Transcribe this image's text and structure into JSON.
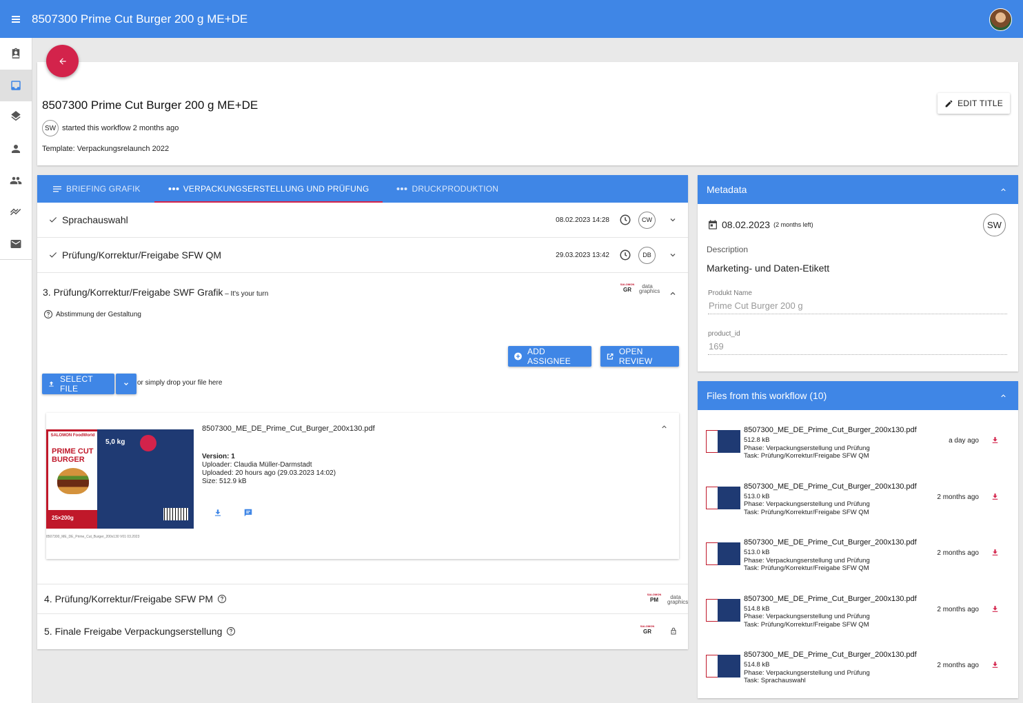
{
  "topbar": {
    "title": "8507300 Prime Cut Burger 200 g ME+DE"
  },
  "header": {
    "title": "8507300 Prime Cut Burger 200 g ME+DE",
    "initials": "SW",
    "started": "started this workflow 2 months ago",
    "template": "Template: Verpackungsrelaunch 2022",
    "edit_label": "EDIT TITLE"
  },
  "tabs": [
    {
      "label": "BRIEFING GRAFIK",
      "icon": "notes-icon"
    },
    {
      "label": "VERPACKUNGSERSTELLUNG UND PRÜFUNG",
      "icon": "steps-icon",
      "active": true
    },
    {
      "label": "DRUCKPRODUKTION",
      "icon": "steps-icon"
    }
  ],
  "steps": {
    "done": [
      {
        "name": "Sprachauswahl",
        "date": "08.02.2023 14:28",
        "initials": "CW"
      },
      {
        "name": "Prüfung/Korrektur/Freigabe SFW QM",
        "date": "29.03.2023 13:42",
        "initials": "DB"
      }
    ],
    "current": {
      "title": "3. Prüfung/Korrektur/Freigabe SWF Grafik",
      "turn": " – It's your turn",
      "logo_gr": "GR",
      "logo_sub": "SALOMON FoodWorld",
      "logo_data": "data graphics",
      "hint": "Abstimmung der Gestaltung",
      "add_assignee": "ADD ASSIGNEE",
      "open_review": "OPEN REVIEW",
      "select_file": "SELECT FILE",
      "drop_text": "or simply drop your file here",
      "file": {
        "name": "8507300_ME_DE_Prime_Cut_Burger_200x130.pdf",
        "version": "Version: 1",
        "uploader": "Uploader: Claudia Müller-Darmstadt",
        "uploaded": "Uploaded: 20 hours ago (29.03.2023 14:02)",
        "size": "Size: 512.9 kB",
        "caption": "8507300_ME_DE_Prime_Cut_Burger_200x130   V01   03.2023",
        "thumb_brand": "SALOMON FoodWorld",
        "thumb_title": "PRIME CUT",
        "thumb_subtitle": "BURGER",
        "thumb_weight": "5,0 kg",
        "thumb_count": "25×200g"
      }
    },
    "later": [
      {
        "name": "4. Prüfung/Korrektur/Freigabe SFW PM",
        "logo": "PM"
      },
      {
        "name": "5. Finale Freigabe Verpackungserstellung",
        "logo": "GR"
      }
    ]
  },
  "metadata": {
    "title": "Metadata",
    "date": "08.02.2023",
    "date_note": "(2 months left)",
    "initials": "SW",
    "description_label": "Description",
    "description": "Marketing- und Daten-Etikett",
    "fields": [
      {
        "label": "Produkt Name",
        "value": "Prime Cut Burger 200 g"
      },
      {
        "label": "product_id",
        "value": "169"
      }
    ]
  },
  "files": {
    "title": "Files from this workflow (10)",
    "items": [
      {
        "name": "8507300_ME_DE_Prime_Cut_Burger_200x130.pdf",
        "size": "512.8 kB",
        "phase": "Phase: Verpackungserstellung und Prüfung",
        "task": "Task: Prüfung/Korrektur/Freigabe SFW QM",
        "age": "a day ago"
      },
      {
        "name": "8507300_ME_DE_Prime_Cut_Burger_200x130.pdf",
        "size": "513.0 kB",
        "phase": "Phase: Verpackungserstellung und Prüfung",
        "task": "Task: Prüfung/Korrektur/Freigabe SFW QM",
        "age": "2 months ago"
      },
      {
        "name": "8507300_ME_DE_Prime_Cut_Burger_200x130.pdf",
        "size": "513.0 kB",
        "phase": "Phase: Verpackungserstellung und Prüfung",
        "task": "Task: Prüfung/Korrektur/Freigabe SFW QM",
        "age": "2 months ago"
      },
      {
        "name": "8507300_ME_DE_Prime_Cut_Burger_200x130.pdf",
        "size": "514.8 kB",
        "phase": "Phase: Verpackungserstellung und Prüfung",
        "task": "Task: Prüfung/Korrektur/Freigabe SFW QM",
        "age": "2 months ago"
      },
      {
        "name": "8507300_ME_DE_Prime_Cut_Burger_200x130.pdf",
        "size": "514.8 kB",
        "phase": "Phase: Verpackungserstellung und Prüfung",
        "task": "Task: Sprachauswahl",
        "age": "2 months ago"
      }
    ]
  },
  "colors": {
    "primary": "#3f86e6",
    "accent": "#d3234b"
  }
}
